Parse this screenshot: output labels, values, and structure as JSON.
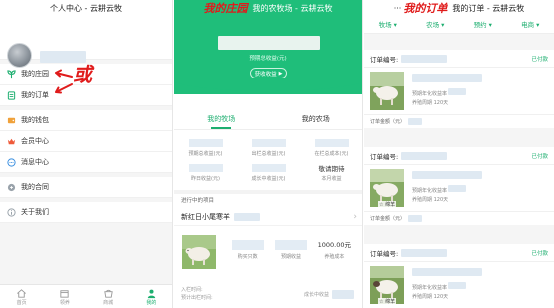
{
  "panel1": {
    "title": "个人中心 - 云耕云牧",
    "overlay_text": "或",
    "menu_group1": [
      {
        "label": "我的庄园",
        "icon": "farm-icon"
      },
      {
        "label": "我的订单",
        "icon": "order-icon"
      }
    ],
    "menu_group2": [
      {
        "label": "我的钱包",
        "icon": "wallet-icon"
      },
      {
        "label": "会员中心",
        "icon": "member-icon"
      },
      {
        "label": "消息中心",
        "icon": "message-icon"
      }
    ],
    "menu_group3": [
      {
        "label": "我的合同",
        "icon": "contract-icon"
      }
    ],
    "menu_group4": [
      {
        "label": "关于我们",
        "icon": "info-icon"
      }
    ],
    "tabbar": [
      {
        "label": "首页",
        "icon": "home-icon",
        "active": false
      },
      {
        "label": "领养",
        "icon": "adopt-icon",
        "active": false
      },
      {
        "label": "商城",
        "icon": "shop-icon",
        "active": false
      },
      {
        "label": "我的",
        "icon": "user-icon",
        "active": true
      }
    ]
  },
  "panel2": {
    "overlay_title": "我的庄园",
    "title": "我的农牧场 - 云耕云牧",
    "hero_subtitle": "预期总收益(元)",
    "hero_button": "获收收益",
    "tabs": [
      {
        "label": "我的牧场",
        "active": true
      },
      {
        "label": "我的农场",
        "active": false
      }
    ],
    "stats_row1": [
      "预期总收益(元)",
      "出栏总收益(元)",
      "在栏总成本(元)"
    ],
    "stats_row2": [
      {
        "label": "昨日收益(元)",
        "value": ""
      },
      {
        "label": "成长中收益(元)",
        "value": ""
      },
      {
        "label": "本月收益",
        "value": "敬请期待"
      }
    ],
    "section_label": "进行中的项目",
    "product_name": "新红日小尾寒羊",
    "product_stats": [
      {
        "label": "购买只数",
        "value": ""
      },
      {
        "label": "预期收益",
        "value": ""
      },
      {
        "label": "养殖成本",
        "value": "1000.00元"
      }
    ],
    "time_labels": [
      "入栏时间:",
      "预计出栏时间:"
    ],
    "growth_label": "成长中收益"
  },
  "panel3": {
    "dots": "···",
    "overlay_title": "我的订单",
    "title": "我的订单 - 云耕云牧",
    "filters": [
      "牧场 ▾",
      "农场 ▾",
      "预约 ▾",
      "电商 ▾"
    ],
    "orders": [
      {
        "label": "订单编号:",
        "status": "已付款",
        "tag": "",
        "yield_label": "预期年化收益率",
        "cycle": "养殖周期 120天",
        "amount_label": "订单金额（元）"
      },
      {
        "label": "订单编号:",
        "status": "已付款",
        "tag": "☆ 绵羊",
        "yield_label": "预期年化收益率",
        "cycle": "养殖周期 120天",
        "amount_label": "订单金额（元）"
      },
      {
        "label": "订单编号:",
        "status": "已付款",
        "tag": "☆ 绵羊",
        "yield_label": "预期年化收益率",
        "cycle": "养殖周期 120天",
        "amount_label": "订单金额（元）"
      }
    ]
  },
  "colors": {
    "brand_green": "#1fbe7a",
    "accent_red": "#e01b1b",
    "link_green": "#1cae6f"
  }
}
